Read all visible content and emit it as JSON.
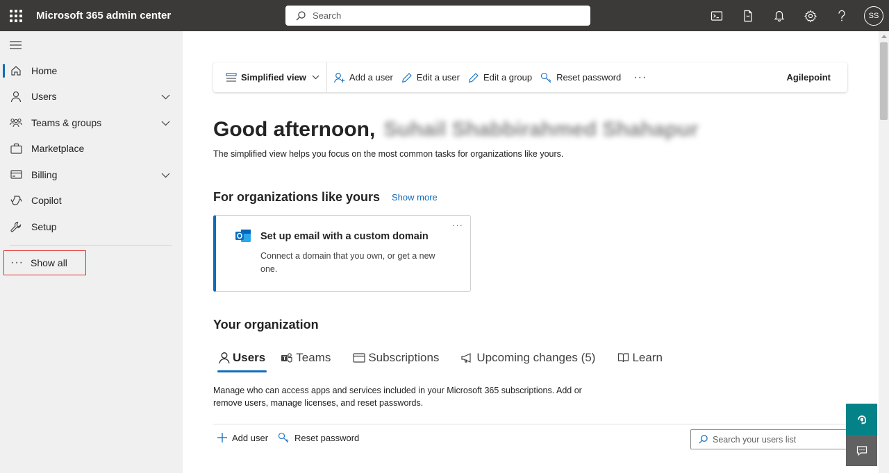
{
  "topbar": {
    "title": "Microsoft 365 admin center",
    "search_placeholder": "Search",
    "avatar_initials": "SS",
    "icons": [
      "terminal-icon",
      "mobile-app-icon",
      "bell-icon",
      "gear-icon",
      "help-icon"
    ]
  },
  "sidebar": {
    "items": [
      {
        "label": "Home",
        "icon": "home-icon",
        "expandable": false,
        "active": true
      },
      {
        "label": "Users",
        "icon": "user-icon",
        "expandable": true
      },
      {
        "label": "Teams & groups",
        "icon": "teams-groups-icon",
        "expandable": true
      },
      {
        "label": "Marketplace",
        "icon": "bag-icon",
        "expandable": false
      },
      {
        "label": "Billing",
        "icon": "credit-card-icon",
        "expandable": true
      },
      {
        "label": "Copilot",
        "icon": "copilot-icon",
        "expandable": false
      },
      {
        "label": "Setup",
        "icon": "wrench-icon",
        "expandable": false
      }
    ],
    "show_all": "Show all"
  },
  "commandbar": {
    "view_label": "Simplified view",
    "add_user": "Add a user",
    "edit_user": "Edit a user",
    "edit_group": "Edit a group",
    "reset_password": "Reset password",
    "more": "···",
    "org_name": "Agilepoint"
  },
  "main": {
    "greeting": "Good afternoon,",
    "greeting_name": "Suhail Shabbirahmed Shahapur",
    "subtext": "The simplified view helps you focus on the most common tasks for organizations like yours.",
    "orgs_section_title": "For organizations like yours",
    "show_more": "Show more",
    "card": {
      "title": "Set up email with a custom domain",
      "description": "Connect a domain that you own, or get a new one.",
      "more": "···"
    },
    "your_org_title": "Your organization",
    "tabs": [
      {
        "label": "Users",
        "active": true
      },
      {
        "label": "Teams"
      },
      {
        "label": "Subscriptions"
      },
      {
        "label": "Upcoming changes (5)"
      },
      {
        "label": "Learn"
      }
    ],
    "manage_text": "Manage who can access apps and services included in your Microsoft 365 subscriptions. Add or remove users, manage licenses, and reset passwords.",
    "add_user_action": "Add user",
    "reset_password_action": "Reset password",
    "users_search_placeholder": "Search your users list"
  },
  "colors": {
    "topbar_bg": "#3b3a39",
    "sidebar_bg": "#f0f0f0",
    "accent_blue": "#0f6cbd",
    "highlight_red": "#e02b2b",
    "help_button_teal": "#038387"
  }
}
